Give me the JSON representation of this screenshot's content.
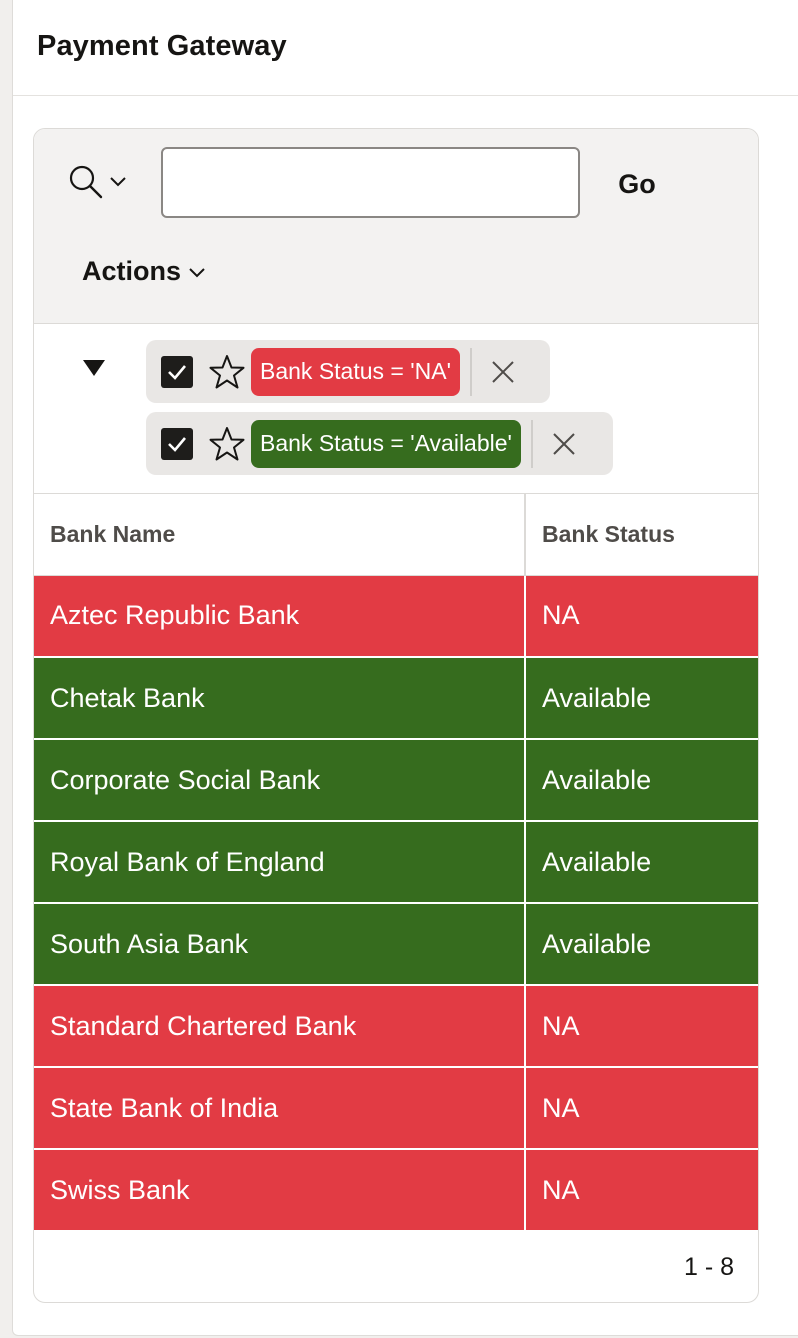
{
  "region": {
    "title": "Payment Gateway"
  },
  "toolbar": {
    "search": {
      "value": "",
      "placeholder": ""
    },
    "go_label": "Go",
    "actions_label": "Actions"
  },
  "filters": [
    {
      "label": "Bank Status = 'NA'",
      "checked": true,
      "color": "#e23b44"
    },
    {
      "label": "Bank Status = 'Available'",
      "checked": true,
      "color": "#366c1e"
    }
  ],
  "table": {
    "columns": [
      "Bank Name",
      "Bank Status"
    ],
    "rows": [
      {
        "bank_name": "Aztec Republic Bank",
        "bank_status": "NA"
      },
      {
        "bank_name": "Chetak Bank",
        "bank_status": "Available"
      },
      {
        "bank_name": "Corporate Social Bank",
        "bank_status": "Available"
      },
      {
        "bank_name": "Royal Bank of England",
        "bank_status": "Available"
      },
      {
        "bank_name": "South Asia Bank",
        "bank_status": "Available"
      },
      {
        "bank_name": "Standard Chartered Bank",
        "bank_status": "NA"
      },
      {
        "bank_name": "State Bank of India",
        "bank_status": "NA"
      },
      {
        "bank_name": "Swiss Bank",
        "bank_status": "NA"
      }
    ]
  },
  "pagination": "1 - 8",
  "colors": {
    "na": "#e23b44",
    "available": "#366c1e"
  },
  "icons": [
    "search-icon",
    "chevron-down-icon",
    "triangle-down-icon",
    "checkmark-icon",
    "star-icon",
    "close-icon"
  ]
}
